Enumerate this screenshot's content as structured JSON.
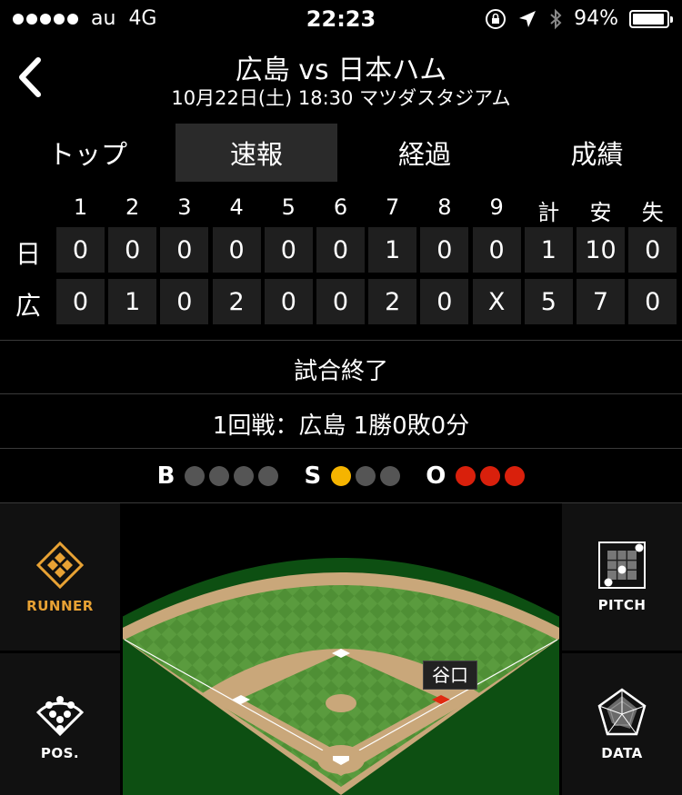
{
  "status_bar": {
    "carrier": "au",
    "network": "4G",
    "time": "22:23",
    "battery": "94%"
  },
  "header": {
    "title": "広島 vs 日本ハム",
    "subtitle": "10月22日(土) 18:30 マツダスタジアム"
  },
  "tabs": [
    {
      "label": "トップ",
      "active": false
    },
    {
      "label": "速報",
      "active": true
    },
    {
      "label": "経過",
      "active": false
    },
    {
      "label": "成績",
      "active": false
    }
  ],
  "scoreboard": {
    "headers": [
      "1",
      "2",
      "3",
      "4",
      "5",
      "6",
      "7",
      "8",
      "9",
      "計",
      "安",
      "失"
    ],
    "teams": [
      {
        "name": "日",
        "scores": [
          "0",
          "0",
          "0",
          "0",
          "0",
          "0",
          "1",
          "0",
          "0",
          "1",
          "10",
          "0"
        ]
      },
      {
        "name": "広",
        "scores": [
          "0",
          "1",
          "0",
          "2",
          "0",
          "0",
          "2",
          "0",
          "X",
          "5",
          "7",
          "0"
        ]
      }
    ]
  },
  "game_status": "試合終了",
  "series_info": "1回戦：広島 1勝0敗0分",
  "count": {
    "balls": {
      "label": "B",
      "lit": 0,
      "total": 4,
      "color": "#555555"
    },
    "strikes": {
      "label": "S",
      "lit": 1,
      "total": 3,
      "color": "#f5b400"
    },
    "outs": {
      "label": "O",
      "lit": 3,
      "total": 3,
      "color": "#d9200c"
    }
  },
  "panels": {
    "runner": {
      "label": "RUNNER",
      "color": "#e8a234"
    },
    "pitch": {
      "label": "PITCH"
    },
    "pos": {
      "label": "POS."
    },
    "data": {
      "label": "DATA"
    }
  },
  "field": {
    "runner_tag": "谷口"
  }
}
